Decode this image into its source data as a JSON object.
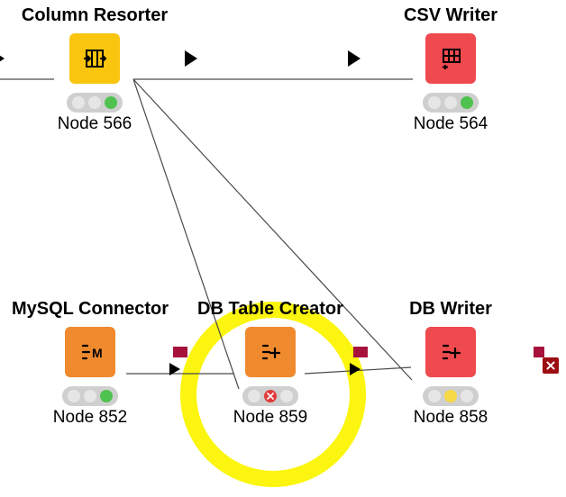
{
  "nodes": {
    "columnResorter": {
      "title": "Column Resorter",
      "nodeLabel": "Node 566"
    },
    "csvWriter": {
      "title": "CSV Writer",
      "nodeLabel": "Node 564"
    },
    "mysqlConnector": {
      "title": "MySQL Connector",
      "nodeLabel": "Node 852"
    },
    "dbTableCreator": {
      "title": "DB Table Creator",
      "nodeLabel": "Node 859"
    },
    "dbWriter": {
      "title": "DB Writer",
      "nodeLabel": "Node 858"
    }
  }
}
